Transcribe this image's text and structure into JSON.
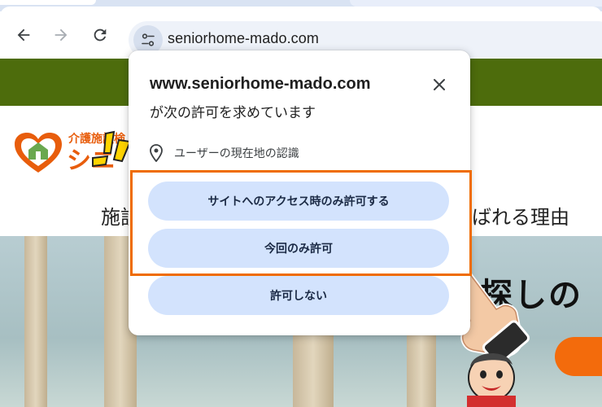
{
  "browser": {
    "url": "seniorhome-mado.com",
    "icons": {
      "back": "back-arrow-icon",
      "forward": "forward-arrow-icon",
      "reload": "reload-icon",
      "site_info": "tune-icon"
    }
  },
  "page": {
    "logo_small": "介護施設検",
    "logo_big": "シニ",
    "heading_left": "施設",
    "heading_right": "ばれる理由",
    "hero_text": "探しの"
  },
  "popup": {
    "title": "www.seniorhome-mado.com",
    "subtitle": "が次の許可を求めています",
    "permission_text": "ユーザーの現在地の認識",
    "buttons": {
      "allow_while_visiting": "サイトへのアクセス時のみ許可する",
      "allow_this_time": "今回のみ許可",
      "deny": "許可しない"
    }
  },
  "colors": {
    "highlight": "#ef6c00",
    "button_bg": "#d3e3fd",
    "green_bar": "#4d6c0c",
    "brand_orange": "#e85d0c"
  }
}
